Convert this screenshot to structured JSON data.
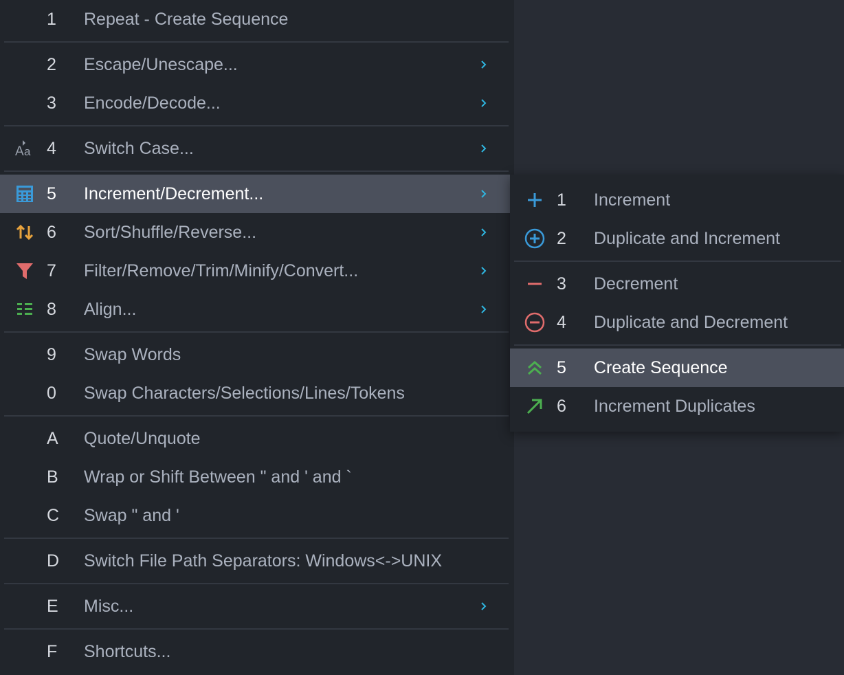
{
  "main_menu": {
    "items": [
      {
        "key": "1",
        "label": "Repeat - Create Sequence",
        "icon": "",
        "submenu": false
      },
      {
        "key": "2",
        "label": "Escape/Unescape...",
        "icon": "",
        "submenu": true
      },
      {
        "key": "3",
        "label": "Encode/Decode...",
        "icon": "",
        "submenu": true
      },
      {
        "key": "4",
        "label": "Switch Case...",
        "icon": "switch-case-icon",
        "submenu": true
      },
      {
        "key": "5",
        "label": "Increment/Decrement...",
        "icon": "calculator-icon",
        "submenu": true
      },
      {
        "key": "6",
        "label": "Sort/Shuffle/Reverse...",
        "icon": "sort-arrows-icon",
        "submenu": true
      },
      {
        "key": "7",
        "label": "Filter/Remove/Trim/Minify/Convert...",
        "icon": "filter-funnel-icon",
        "submenu": true
      },
      {
        "key": "8",
        "label": "Align...",
        "icon": "align-list-icon",
        "submenu": true
      },
      {
        "key": "9",
        "label": "Swap Words",
        "icon": "",
        "submenu": false
      },
      {
        "key": "0",
        "label": "Swap Characters/Selections/Lines/Tokens",
        "icon": "",
        "submenu": false
      },
      {
        "key": "A",
        "label": "Quote/Unquote",
        "icon": "",
        "submenu": false
      },
      {
        "key": "B",
        "label": "Wrap or Shift Between \" and ' and `",
        "icon": "",
        "submenu": false
      },
      {
        "key": "C",
        "label": "Swap \" and '",
        "icon": "",
        "submenu": false
      },
      {
        "key": "D",
        "label": "Switch File Path Separators: Windows<->UNIX",
        "icon": "",
        "submenu": false
      },
      {
        "key": "E",
        "label": "Misc...",
        "icon": "",
        "submenu": true
      },
      {
        "key": "F",
        "label": "Shortcuts...",
        "icon": "",
        "submenu": false
      }
    ],
    "active_key": "5"
  },
  "sub_menu": {
    "items": [
      {
        "key": "1",
        "label": "Increment",
        "icon": "plus-icon"
      },
      {
        "key": "2",
        "label": "Duplicate and Increment",
        "icon": "circle-plus-icon"
      },
      {
        "key": "3",
        "label": "Decrement",
        "icon": "minus-icon"
      },
      {
        "key": "4",
        "label": "Duplicate and Decrement",
        "icon": "circle-minus-icon"
      },
      {
        "key": "5",
        "label": "Create Sequence",
        "icon": "double-chevron-up-icon"
      },
      {
        "key": "6",
        "label": "Increment Duplicates",
        "icon": "arrow-up-right-icon"
      }
    ],
    "active_key": "5"
  },
  "colors": {
    "menu_bg": "#21252b",
    "page_bg": "#282c34",
    "active_bg": "#4b505c",
    "text": "#abb2bf",
    "chevron": "#2fb6e0",
    "blue_icon": "#3a9ad9",
    "orange_icon": "#e8a33d",
    "red_icon": "#e06c6c",
    "green_icon": "#4caf50"
  }
}
